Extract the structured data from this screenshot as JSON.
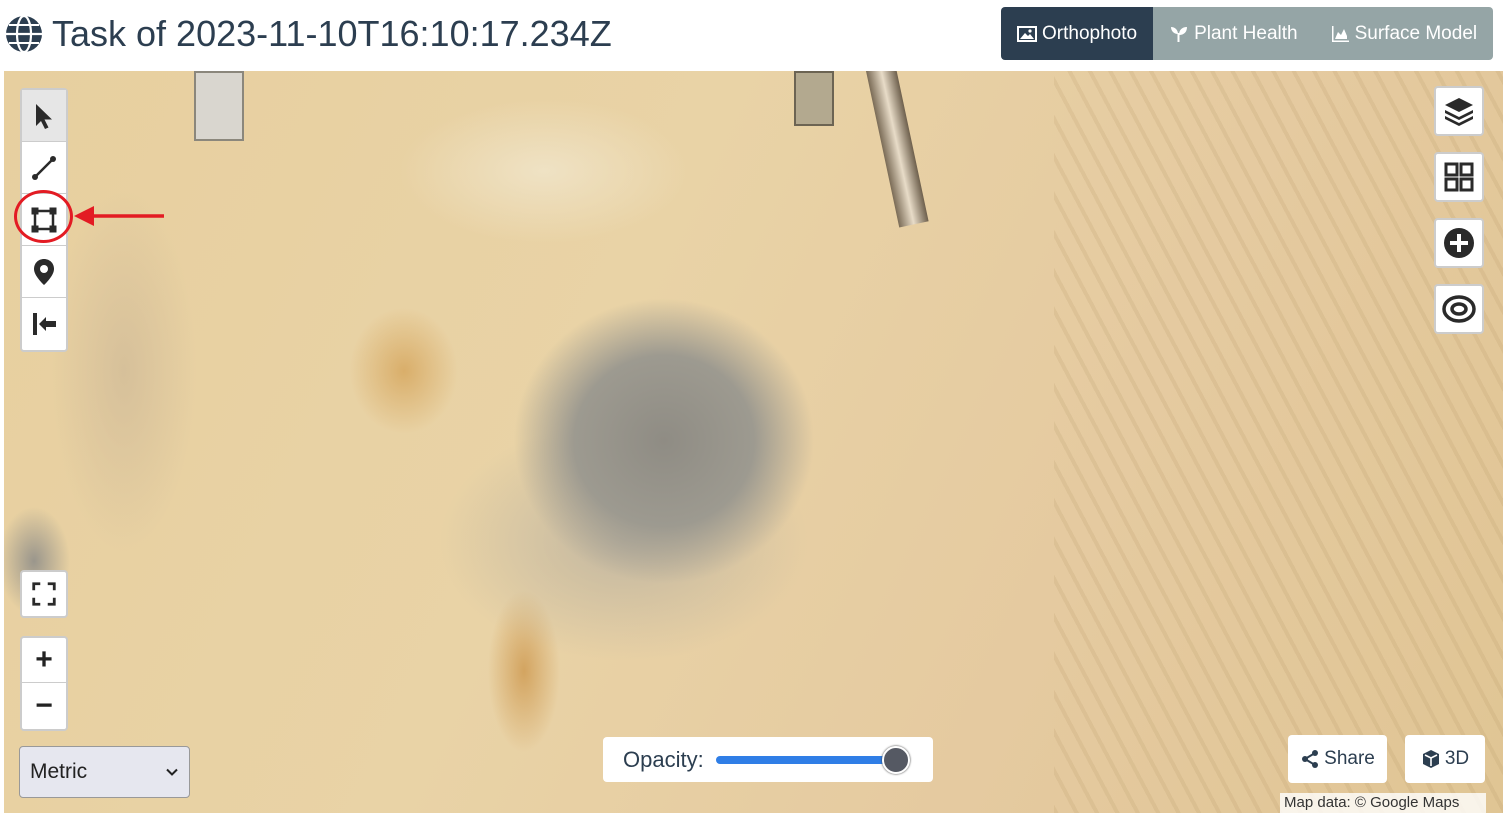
{
  "header": {
    "title": "Task of 2023-11-10T16:10:17.234Z",
    "tabs": [
      {
        "label": "Orthophoto",
        "icon": "image-icon",
        "active": true
      },
      {
        "label": "Plant Health",
        "icon": "plant-icon",
        "active": false
      },
      {
        "label": "Surface Model",
        "icon": "area-chart-icon",
        "active": false
      }
    ]
  },
  "toolbar": {
    "tools": [
      "pointer-icon",
      "line-icon",
      "polygon-icon",
      "marker-icon",
      "exit-icon"
    ],
    "highlighted_tool": "polygon-icon"
  },
  "right_controls": [
    "layers-icon",
    "grid-icon",
    "plus-circle-icon",
    "target-icon"
  ],
  "zoom": {
    "in": "+",
    "out": "−"
  },
  "units": {
    "selected": "Metric"
  },
  "opacity": {
    "label": "Opacity:",
    "value": 100
  },
  "actions": {
    "share": "Share",
    "three_d": "3D"
  },
  "attribution": "Map data: © Google Maps",
  "colors": {
    "active_tab": "#2c3e50",
    "inactive_tab": "#95a5a6",
    "highlight": "#e31b23",
    "slider": "#2f7ee6"
  }
}
